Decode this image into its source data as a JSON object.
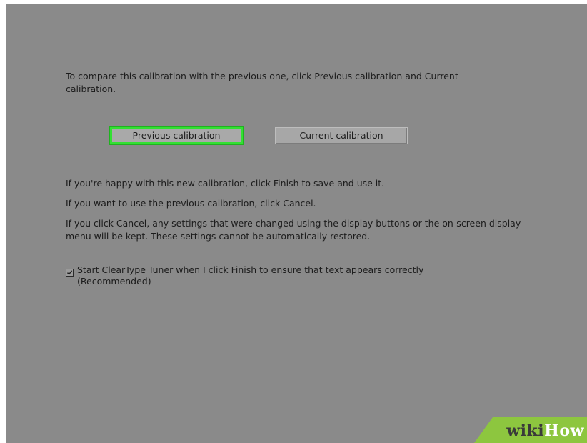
{
  "instructions": {
    "intro": "To compare this calibration with the previous one, click Previous calibration and Current calibration.",
    "happy": "If you're happy with this new calibration, click Finish to save and use it.",
    "previous": "If you want to use the previous calibration, click Cancel.",
    "cancel_note": "If you click Cancel, any settings that were changed using the display buttons or the on-screen display menu will be kept. These settings cannot be automatically restored."
  },
  "buttons": {
    "previous_label": "Previous calibration",
    "current_label": "Current calibration"
  },
  "checkbox": {
    "label": "Start ClearType Tuner when I click Finish to ensure that text appears correctly (Recommended)",
    "checked": true
  },
  "watermark": {
    "part1": "wiki",
    "part2": "How"
  },
  "colors": {
    "background": "#8a8a8a",
    "focus_highlight": "#33e033",
    "watermark_green": "#8dc63f"
  }
}
